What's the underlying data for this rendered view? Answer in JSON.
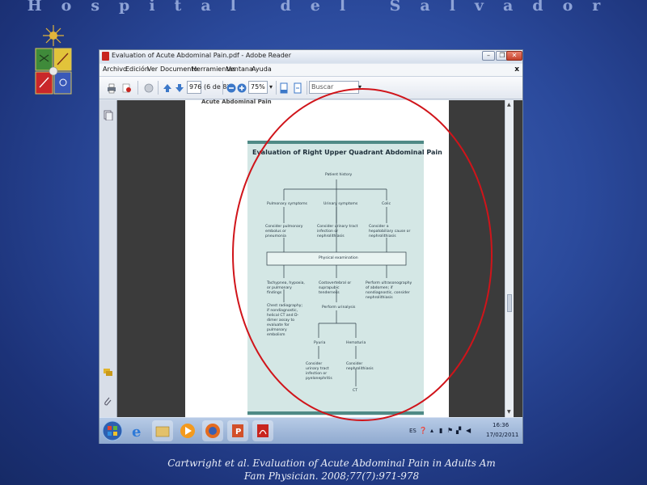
{
  "slide": {
    "title": "Hospital del Salvador",
    "caption_line1": "Cartwright  et al. Evaluation of Acute Abdominal Pain in Adults Am",
    "caption_line2": "Fam Physician. 2008;77(7):971-978"
  },
  "window": {
    "title": "Evaluation of Acute Abdominal Pain.pdf - Adobe Reader",
    "minimize_icon": "minimize-icon",
    "maximize_icon": "restore-icon",
    "close_icon": "close-icon"
  },
  "menu": {
    "items": [
      "Archivo",
      "Edición",
      "Ver",
      "Documento",
      "Herramientas",
      "Ventana",
      "Ayuda"
    ],
    "close_label": "x"
  },
  "toolbar": {
    "page_number": "976",
    "page_of": "(6 de 8)",
    "zoom": "75%",
    "search_placeholder": "Buscar"
  },
  "document": {
    "page_header": "Acute Abdominal Pain",
    "figure": {
      "title": "Evaluation of Right Upper Quadrant Abdominal Pain",
      "nodes": {
        "history": "Patient history",
        "pulmonary": "Pulmonary symptoms",
        "urinary": "Urinary symptoms",
        "colic": "Colic",
        "consider_pulmonary": "Consider pulmonary embolus or pneumonia",
        "consider_urinary": "Consider urinary tract infection or nephrolithiasis",
        "consider_hepatobiliary": "Consider a hepatobiliary cause or nephrolithiasis",
        "physical": "Physical examination",
        "tachypnea": "Tachypnea, hypoxia, or pulmonary findings",
        "costovertebral": "Costovertebral or suprapubic tenderness",
        "ultrasound": "Perform ultrasonography of abdomen; if nondiagnostic, consider nephrolithiasis",
        "chest": "Chest radiography; if nondiagnostic, helical CT and D-dimer assay to evaluate for pulmonary embolism",
        "urinalysis": "Perform urinalysis",
        "pyuria": "Pyuria",
        "hematuria": "Hematuria",
        "consider_uti": "Consider urinary tract infection or pyelonephritis",
        "consider_nephro": "Consider nephrolithiasis",
        "ct": "CT"
      }
    }
  },
  "taskbar": {
    "language": "ES",
    "time": "16:36",
    "date": "17/02/2011"
  },
  "colors": {
    "slide_background": "#2b4a9c",
    "annotation_circle": "#d0141a",
    "figure_background": "#d4e7e5",
    "figure_rule": "#4f8a86"
  }
}
